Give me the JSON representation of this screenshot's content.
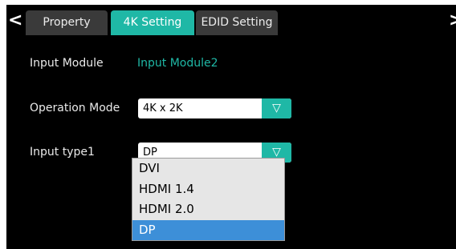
{
  "tabs": [
    {
      "label": "Property",
      "active": false
    },
    {
      "label": "4K Setting",
      "active": true
    },
    {
      "label": "EDID Setting",
      "active": false
    }
  ],
  "nav": {
    "back_glyph": "<",
    "forward_glyph": ">"
  },
  "fields": {
    "input_module": {
      "label": "Input Module",
      "value": "Input Module2"
    },
    "operation_mode": {
      "label": "Operation Mode",
      "value": "4K x 2K"
    },
    "input_type1": {
      "label": "Input type1",
      "value": "DP"
    }
  },
  "dropdown": {
    "arrow_glyph": "▽",
    "options": [
      "DVI",
      "HDMI 1.4",
      "HDMI 2.0",
      "DP"
    ],
    "selected": "DP"
  },
  "colors": {
    "accent": "#1fb8a6",
    "highlight": "#3d8fd8",
    "background": "#000000"
  },
  "icons": {
    "back": "chevron-left-icon",
    "forward": "chevron-right-icon",
    "dropdown": "triangle-down-icon"
  }
}
